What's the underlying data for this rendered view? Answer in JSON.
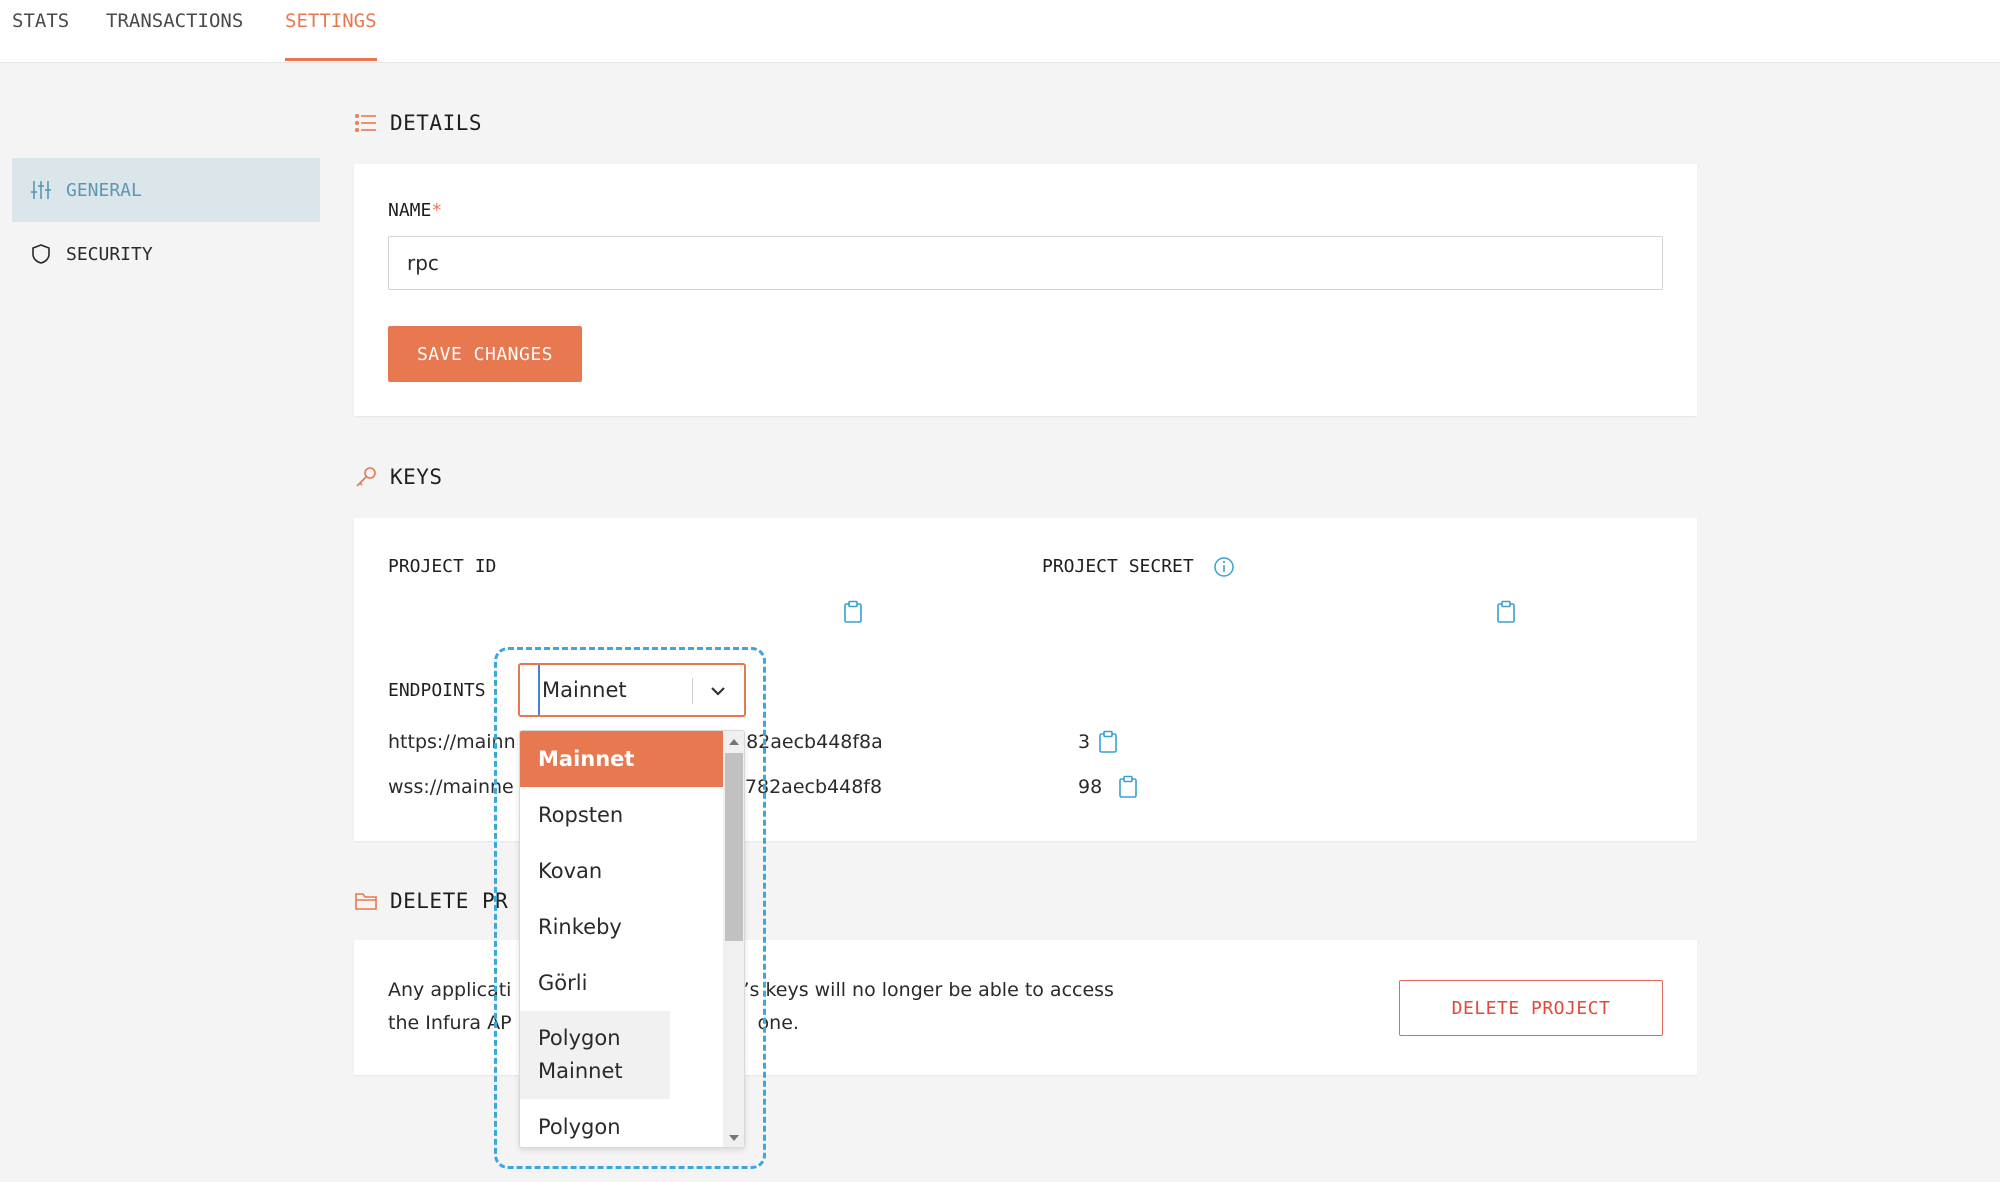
{
  "tabs": [
    {
      "label": "STATS"
    },
    {
      "label": "TRANSACTIONS"
    },
    {
      "label": "SETTINGS"
    }
  ],
  "active_tab": "SETTINGS",
  "sidebar": {
    "items": [
      {
        "label": "GENERAL",
        "icon": "sliders-icon",
        "active": true
      },
      {
        "label": "SECURITY",
        "icon": "shield-icon",
        "active": false
      }
    ]
  },
  "details": {
    "title": "DETAILS",
    "name_label": "NAME",
    "required_mark": "*",
    "name_value": "rpc",
    "save_label": "SAVE CHANGES"
  },
  "keys": {
    "title": "KEYS",
    "project_id_label": "PROJECT ID",
    "project_secret_label": "PROJECT SECRET",
    "endpoints_label": "ENDPOINTS",
    "endpoint_https_prefix": "https://mainn",
    "endpoint_https_mid": "782aecb448f8a",
    "endpoint_https_end": "3",
    "endpoint_wss_prefix": "wss://mainne",
    "endpoint_wss_mid": "la782aecb448f8",
    "endpoint_wss_end": "98"
  },
  "network_select": {
    "value": "Mainnet",
    "options": [
      "Mainnet",
      "Ropsten",
      "Kovan",
      "Rinkeby",
      "Görli",
      "Polygon Mainnet",
      "Polygon"
    ]
  },
  "delete": {
    "title_visible": "DELETE PR",
    "text_line1_a": "Any applicati",
    "text_line1_b": "’s keys will no longer be able to access",
    "text_line2_a": "the Infura AP",
    "text_line2_b": "one.",
    "button_label": "DELETE PROJECT"
  },
  "colors": {
    "accent": "#e8784f",
    "nav_active_bg": "#dbe6ea",
    "nav_active_text": "#5c97b0",
    "danger": "#e04a3a",
    "highlight": "#3aa8df"
  }
}
